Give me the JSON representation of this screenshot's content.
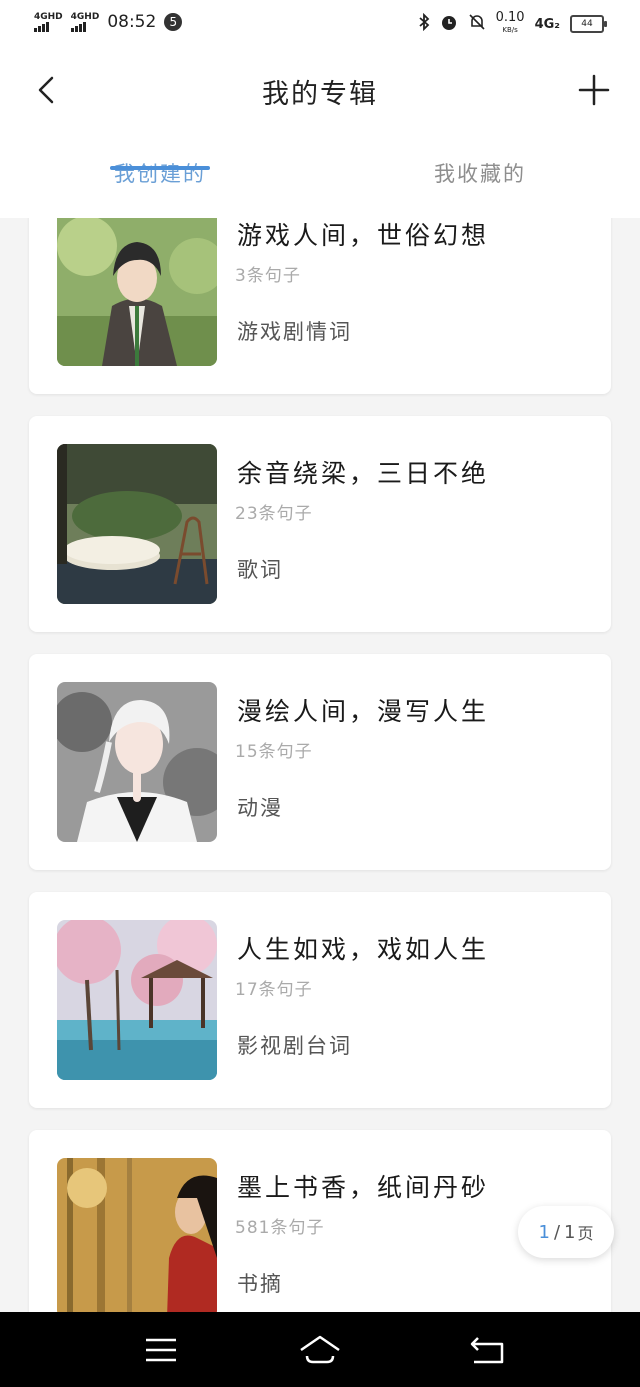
{
  "status_bar": {
    "signal1": "4GHD",
    "signal2": "4GHD",
    "time": "08:52",
    "notif_count": "5",
    "speed_value": "0.10",
    "speed_unit": "KB/s",
    "net_type": "4G₂",
    "battery": "44"
  },
  "header": {
    "title": "我的专辑",
    "back_icon": "chevron-left-icon",
    "add_icon": "plus-icon"
  },
  "tabs": [
    {
      "label": "我创建的",
      "active": true
    },
    {
      "label": "我收藏的",
      "active": false
    }
  ],
  "albums": [
    {
      "title": "游戏人间，世俗幻想",
      "count": "3条句子",
      "category": "游戏剧情词"
    },
    {
      "title": "余音绕梁，三日不绝",
      "count": "23条句子",
      "category": "歌词"
    },
    {
      "title": "漫绘人间，漫写人生",
      "count": "15条句子",
      "category": "动漫"
    },
    {
      "title": "人生如戏，戏如人生",
      "count": "17条句子",
      "category": "影视剧台词"
    },
    {
      "title": "墨上书香，纸间丹砂",
      "count": "581条句子",
      "category": "书摘"
    }
  ],
  "pager": {
    "current": "1",
    "separator": "/",
    "total": "1",
    "unit": "页"
  },
  "colors": {
    "accent": "#4a8fd9",
    "tab_active": "#6a9fd6",
    "background": "#f4f4f4"
  }
}
